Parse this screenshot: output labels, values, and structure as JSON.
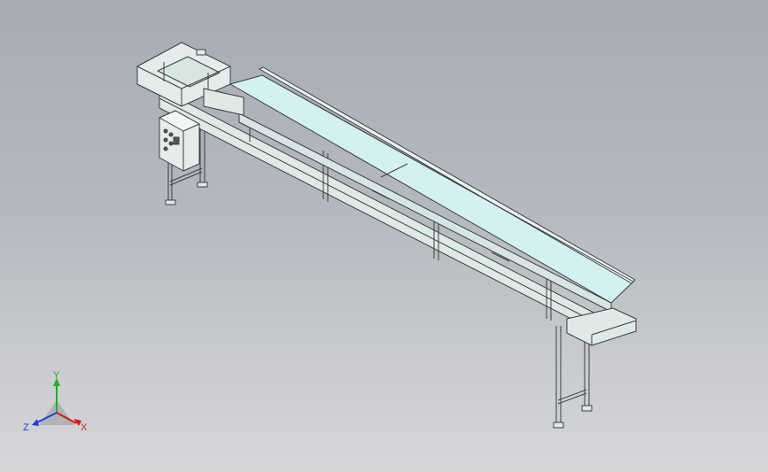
{
  "viewport": {
    "background_top": "#a7abb3",
    "background_bottom": "#d6d7d9"
  },
  "model": {
    "name": "",
    "frame_color": "#dfe9e6",
    "belt_color": "#d4f1f2",
    "edge_color": "#3a3f3f",
    "control_box_color": "#e6ecec"
  },
  "triad": {
    "x_label": "X",
    "y_label": "Y",
    "z_label": "Z",
    "x_color": "#d11a1a",
    "y_color": "#1db31d",
    "z_color": "#1e3fd6"
  }
}
